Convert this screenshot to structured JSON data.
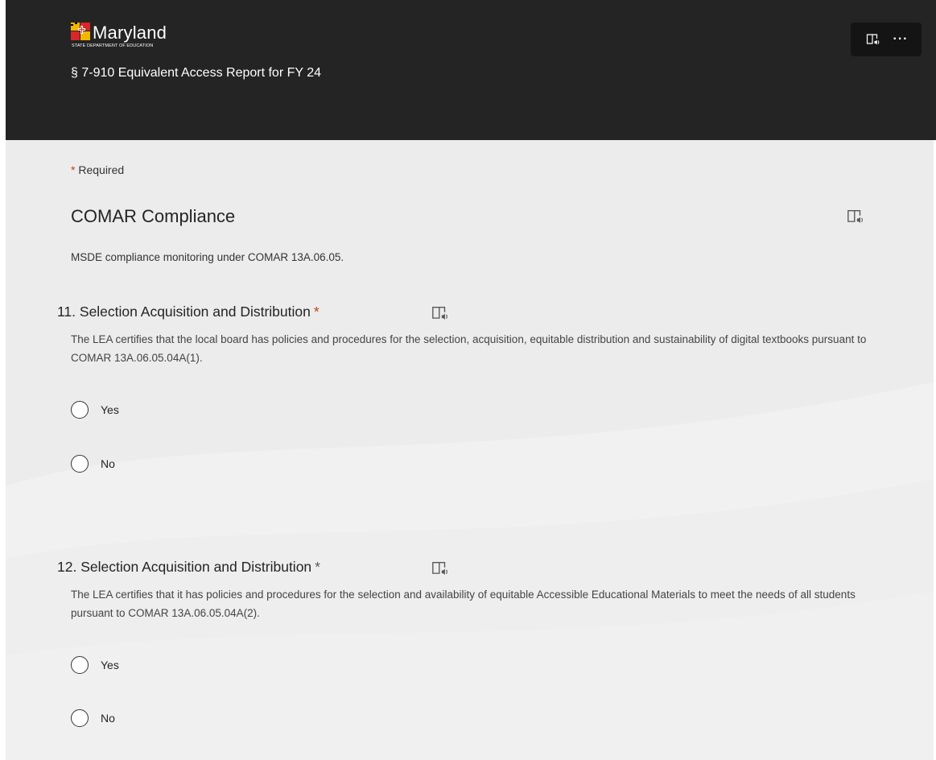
{
  "header": {
    "brand_name": "Maryland",
    "brand_subtitle": "STATE DEPARTMENT OF EDUCATION",
    "form_title": "§ 7-910 Equivalent Access Report for FY 24",
    "more_label": "···",
    "reader_icon": "immersive-reader-icon",
    "background_color": "#242424"
  },
  "required_note": {
    "star": "*",
    "text": "Required"
  },
  "section": {
    "title": "COMAR Compliance",
    "description": "MSDE compliance monitoring under COMAR 13A.06.05."
  },
  "questions": [
    {
      "title": "11. Selection Acquisition and Distribution",
      "required_star": "*",
      "description": "The LEA certifies that the local board has policies and procedures for the selection, acquisition, equitable distribution and sustainability of digital textbooks pursuant to COMAR 13A.06.05.04A(1).",
      "options": [
        "Yes",
        "No"
      ]
    },
    {
      "title": "12. Selection Acquisition and Distribution",
      "required_star": "*",
      "description": "The LEA certifies that it has policies and procedures for the selection and availability of equitable Accessible Educational Materials to meet the needs of all students pursuant to COMAR 13A.06.05.04A(2).",
      "options": [
        "Yes",
        "No"
      ]
    }
  ],
  "colors": {
    "required_star": "#c43e1c",
    "body_background": "#ececec"
  }
}
